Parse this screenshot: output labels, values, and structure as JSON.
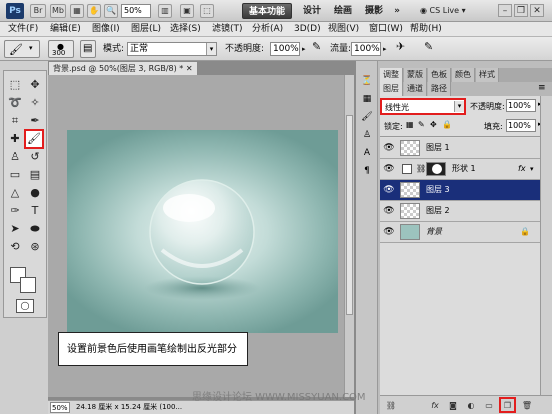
{
  "app": {
    "logo": "Ps",
    "zoom": "50%",
    "workspace_essentials": "基本功能",
    "workspaces": [
      "设计",
      "绘画",
      "摄影"
    ],
    "more": "»",
    "cslive": "CS Live"
  },
  "menu": [
    "文件(F)",
    "编辑(E)",
    "图像(I)",
    "图层(L)",
    "选择(S)",
    "滤镜(T)",
    "分析(A)",
    "3D(D)",
    "视图(V)",
    "窗口(W)",
    "帮助(H)"
  ],
  "options": {
    "brush_size": "300",
    "mode_label": "模式:",
    "mode_value": "正常",
    "opacity_label": "不透明度:",
    "opacity_value": "100%",
    "flow_label": "流量:",
    "flow_value": "100%"
  },
  "document": {
    "tab_title": "背景.psd @ 50%(图层 3, RGB/8) *",
    "status_zoom": "50%",
    "status_info": "24.18 厘米 x 15.24 厘米 (100..."
  },
  "instruction": "设置前景色后使用画笔绘制出反光部分",
  "panels": {
    "adj_tabs": [
      "调整",
      "蒙版",
      "色板",
      "颜色",
      "样式"
    ],
    "layer_tabs": [
      "图层",
      "通道",
      "路径"
    ],
    "blend_mode": "线性光",
    "opacity_label": "不透明度:",
    "opacity_value": "100%",
    "lock_label": "锁定:",
    "fill_label": "填充:",
    "fill_value": "100%",
    "layers": [
      {
        "name": "图层 1",
        "selected": false
      },
      {
        "name": "形状 1",
        "selected": false,
        "fx": "fx"
      },
      {
        "name": "图层 3",
        "selected": true
      },
      {
        "name": "图层 2",
        "selected": false
      },
      {
        "name": "背景",
        "selected": false,
        "lock": "🔒"
      }
    ]
  },
  "watermark": "思缘设计论坛 WWW.MISSYUAN.COM",
  "colors": {
    "accent": "#e21d1d",
    "selected_layer": "#1a2f7a"
  }
}
